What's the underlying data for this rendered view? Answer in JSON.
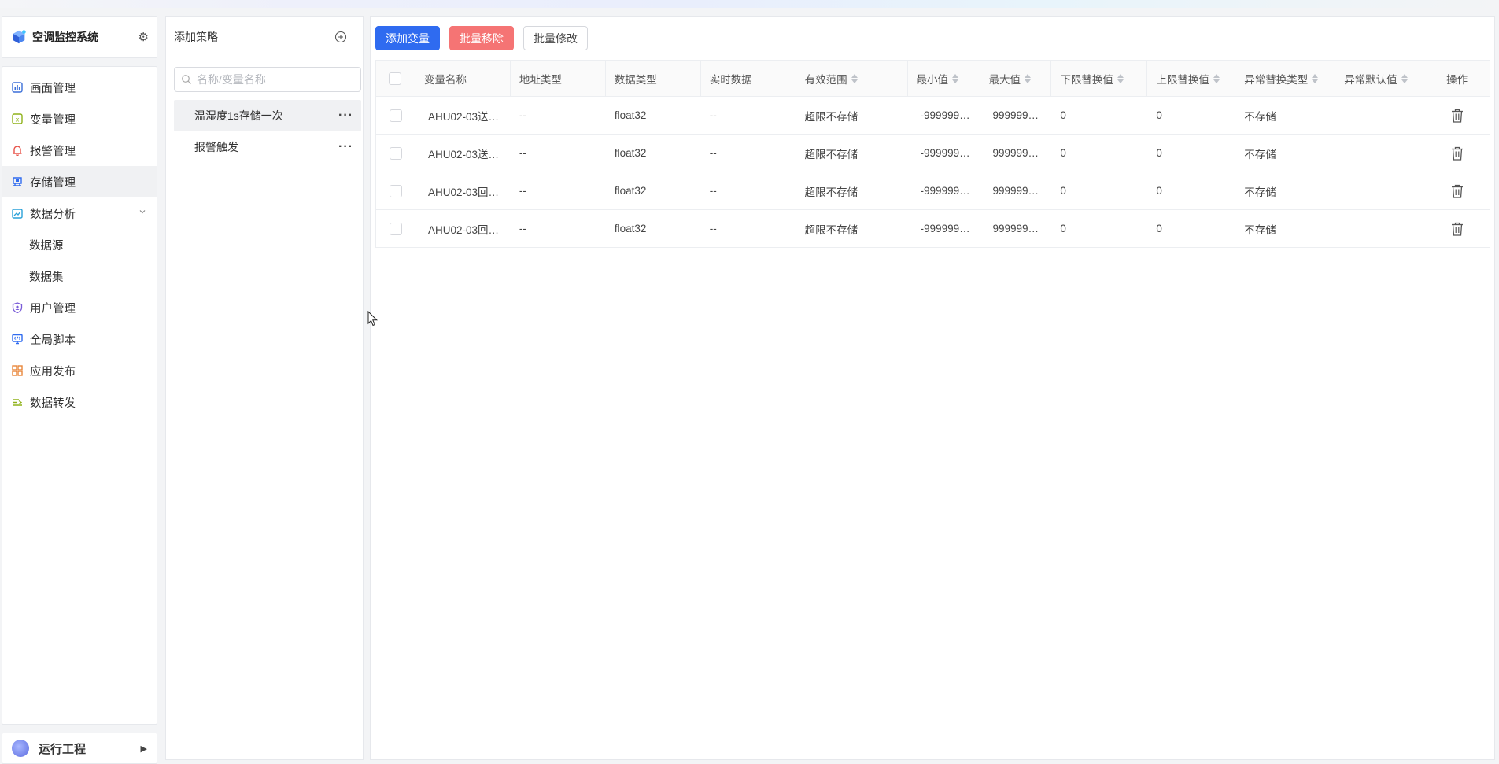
{
  "app": {
    "title": "空调监控系统"
  },
  "sidebar": {
    "items": [
      {
        "label": "画面管理",
        "icon": "chart-board-icon",
        "color": "#3b6fd8"
      },
      {
        "label": "变量管理",
        "icon": "variable-icon",
        "color": "#8fb21a"
      },
      {
        "label": "报警管理",
        "icon": "bell-icon",
        "color": "#e8534a"
      },
      {
        "label": "存储管理",
        "icon": "storage-icon",
        "color": "#2f6bf0"
      },
      {
        "label": "数据分析",
        "icon": "analysis-icon",
        "color": "#2aa1d8"
      },
      {
        "label": "数据源",
        "icon": "",
        "color": ""
      },
      {
        "label": "数据集",
        "icon": "",
        "color": ""
      },
      {
        "label": "用户管理",
        "icon": "shield-user-icon",
        "color": "#7a5cd8"
      },
      {
        "label": "全局脚本",
        "icon": "monitor-script-icon",
        "color": "#2f6bf0"
      },
      {
        "label": "应用发布",
        "icon": "grid-apps-icon",
        "color": "#e8863a"
      },
      {
        "label": "数据转发",
        "icon": "forward-icon",
        "color": "#8fb21a"
      }
    ],
    "run_project": "运行工程"
  },
  "strategy": {
    "title": "添加策略",
    "search_placeholder": "名称/变量名称",
    "items": [
      {
        "label": "温湿度1s存储一次"
      },
      {
        "label": "报警触发"
      }
    ]
  },
  "toolbar": {
    "add_label": "添加变量",
    "batch_remove_label": "批量移除",
    "batch_edit_label": "批量修改"
  },
  "table": {
    "headers": {
      "name": "变量名称",
      "addr_type": "地址类型",
      "data_type": "数据类型",
      "realtime": "实时数据",
      "valid_range": "有效范围",
      "min": "最小值",
      "max": "最大值",
      "lower_replace": "下限替换值",
      "upper_replace": "上限替换值",
      "abnormal_type": "异常替换类型",
      "abnormal_default": "异常默认值",
      "ops": "操作"
    },
    "rows": [
      {
        "name": "AHU02-03送…",
        "addr_type": "--",
        "data_type": "float32",
        "realtime": "--",
        "valid_range": "超限不存储",
        "min": "-999999…",
        "max": "999999…",
        "lower_replace": "0",
        "upper_replace": "0",
        "abnormal_type": "不存储",
        "abnormal_default": ""
      },
      {
        "name": "AHU02-03送…",
        "addr_type": "--",
        "data_type": "float32",
        "realtime": "--",
        "valid_range": "超限不存储",
        "min": "-999999…",
        "max": "999999…",
        "lower_replace": "0",
        "upper_replace": "0",
        "abnormal_type": "不存储",
        "abnormal_default": ""
      },
      {
        "name": "AHU02-03回…",
        "addr_type": "--",
        "data_type": "float32",
        "realtime": "--",
        "valid_range": "超限不存储",
        "min": "-999999…",
        "max": "999999…",
        "lower_replace": "0",
        "upper_replace": "0",
        "abnormal_type": "不存储",
        "abnormal_default": ""
      },
      {
        "name": "AHU02-03回…",
        "addr_type": "--",
        "data_type": "float32",
        "realtime": "--",
        "valid_range": "超限不存储",
        "min": "-999999…",
        "max": "999999…",
        "lower_replace": "0",
        "upper_replace": "0",
        "abnormal_type": "不存储",
        "abnormal_default": ""
      }
    ]
  },
  "colors": {
    "primary": "#2f6bf0",
    "danger": "#f57474"
  }
}
